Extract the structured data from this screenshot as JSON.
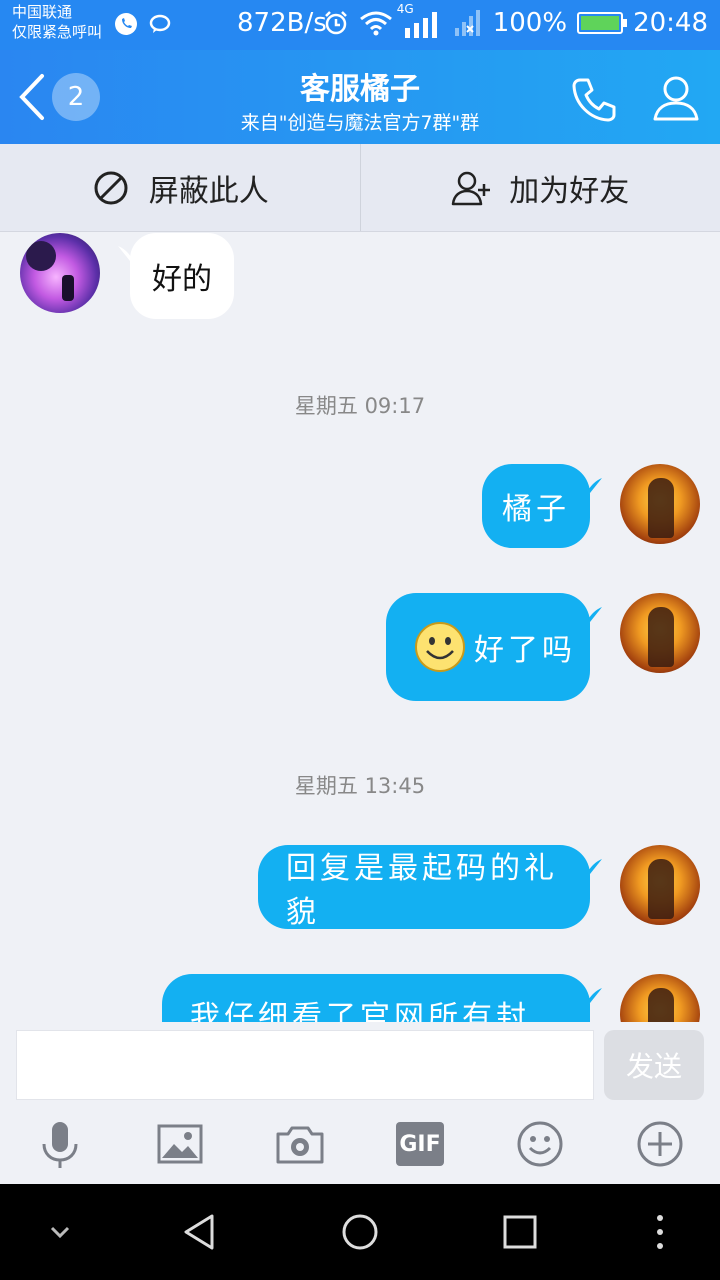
{
  "status_bar": {
    "carrier": "中国联通",
    "carrier_note": "仅限紧急呼叫",
    "network_speed": "872B/s",
    "network_type": "4G",
    "battery": "100%",
    "time": "20:48"
  },
  "title_bar": {
    "unread_count": "2",
    "title": "客服橘子",
    "subtitle": "来自\"创造与魔法官方7群\"群"
  },
  "actions": {
    "block_label": "屏蔽此人",
    "add_friend_label": "加为好友"
  },
  "messages": {
    "m1_text": "好的",
    "time1": "星期五 09:17",
    "m2_text": "橘子",
    "m3_text": "好了吗",
    "time2": "星期五 13:45",
    "m4_text": "回复是最起码的礼貌",
    "m5_text": "我仔细看了官网所有封号帖"
  },
  "input": {
    "text_value": "",
    "send_label": "发送"
  },
  "toolbar": {
    "gif_label": "GIF"
  },
  "colors": {
    "header_start": "#2a86f1",
    "header_end": "#22a8f3",
    "bubble_out": "#13b0f2",
    "bubble_in": "#ffffff",
    "background": "#eff1f6"
  }
}
